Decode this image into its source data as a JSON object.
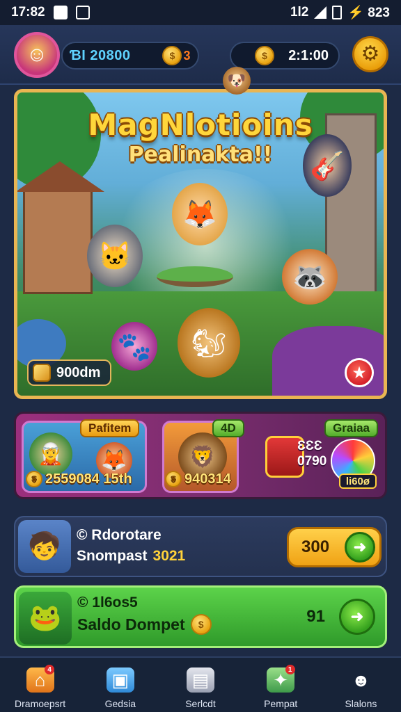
{
  "status_bar": {
    "time": "17:82",
    "right_text": "1l2",
    "battery_text": "⚡ 823"
  },
  "top_bar": {
    "currency1_value": "ƁI 20800",
    "currency1_suffix": "3",
    "currency2_value": "2:1:00",
    "icons": [
      "avatar",
      "coin-icon",
      "pet-icon",
      "gear-icon"
    ]
  },
  "hero": {
    "title": "MagNlotioins",
    "subtitle": "Pealinakta!!",
    "badge_value": "900dm"
  },
  "promo": {
    "card1_tag": "Pafitem",
    "card1_price": "2559084 15th",
    "card2_tag": "4D",
    "card2_price": "940314",
    "chest_line1": "ƐƐƐ",
    "chest_line2": "0790",
    "tag_right": "Graiaa",
    "ball_label": "li60ø"
  },
  "rows": [
    {
      "line1": "© Rdorotare",
      "line2": "Snompast",
      "line2_accent": "3021",
      "button_value": "300"
    },
    {
      "line1": "© 1l6os5",
      "line2": "Saldo Dompet",
      "value": "91"
    }
  ],
  "bottom_nav": [
    {
      "label": "Dramoepsrt",
      "icon": "home-icon"
    },
    {
      "label": "Gedsia",
      "icon": "cube-icon"
    },
    {
      "label": "Serlcdt",
      "icon": "box-icon"
    },
    {
      "label": "Pempat",
      "icon": "map-icon"
    },
    {
      "label": "Slalons",
      "icon": "user-icon"
    }
  ],
  "colors": {
    "background": "#1d2a45",
    "accent_gold": "#ffd04a",
    "accent_green": "#5cd34a",
    "promo_purple": "#9c2f7d"
  }
}
